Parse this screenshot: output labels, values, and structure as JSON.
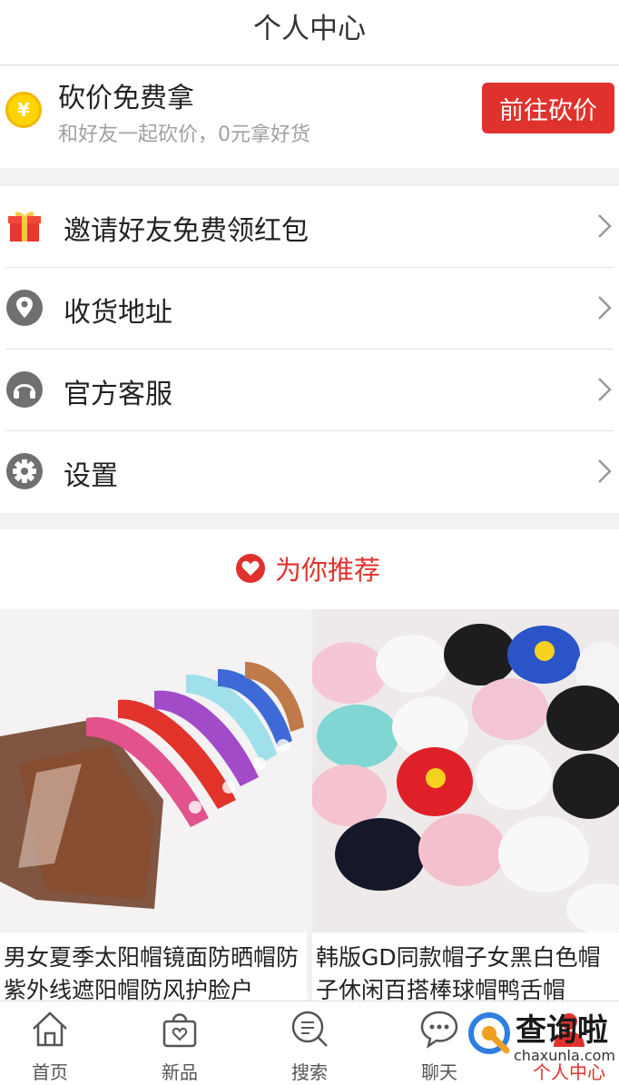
{
  "header": {
    "title": "个人中心"
  },
  "bargain": {
    "title": "砍价免费拿",
    "subtitle": "和好友一起砍价，0元拿好货",
    "button": "前往砍价",
    "coin_symbol": "¥"
  },
  "menu": {
    "items": [
      {
        "label": "邀请好友免费领红包",
        "icon": "gift-icon"
      },
      {
        "label": "收货地址",
        "icon": "location-pin-icon"
      },
      {
        "label": "官方客服",
        "icon": "headset-icon"
      },
      {
        "label": "设置",
        "icon": "gear-icon"
      }
    ]
  },
  "recommend": {
    "label": "为你推荐"
  },
  "products": [
    {
      "name": "男女夏季太阳帽镜面防晒帽防紫外线遮阳帽防风护脸户"
    },
    {
      "name": "韩版GD同款帽子女黑白色帽子休闲百搭棒球帽鸭舌帽"
    }
  ],
  "tabbar": {
    "tabs": [
      {
        "label": "首页",
        "icon": "home-icon"
      },
      {
        "label": "新品",
        "icon": "shopping-bag-icon"
      },
      {
        "label": "搜索",
        "icon": "search-icon"
      },
      {
        "label": "聊天",
        "icon": "chat-icon"
      },
      {
        "label": "个人中心",
        "icon": "person-icon"
      }
    ]
  },
  "watermark": {
    "text": "查询啦",
    "url": "chaxunla.com"
  },
  "colors": {
    "accent": "#e0322c",
    "coin": "#ffd400",
    "background": "#f2f2f2"
  }
}
